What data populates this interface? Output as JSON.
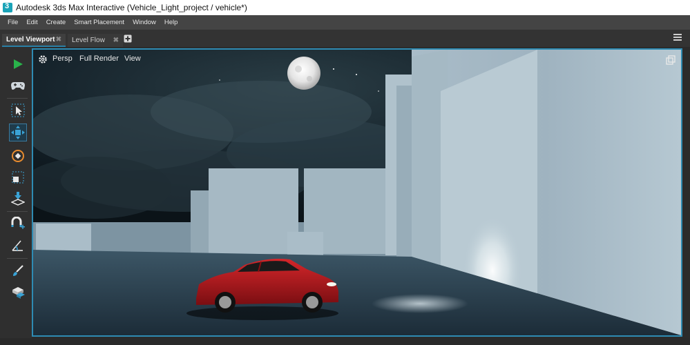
{
  "window": {
    "title": "Autodesk 3ds Max Interactive (Vehicle_Light_project / vehicle*)"
  },
  "menu": [
    "File",
    "Edit",
    "Create",
    "Smart Placement",
    "Window",
    "Help"
  ],
  "tabs": [
    {
      "label": "Level Viewport",
      "active": true
    },
    {
      "label": "Level Flow",
      "active": false
    }
  ],
  "viewport": {
    "camera_label": "Persp",
    "render_label": "Full Render",
    "view_label": "View"
  },
  "toolbar": {
    "tools": [
      "play-icon",
      "gamepad-icon",
      "select-icon",
      "move-icon",
      "rotate-icon",
      "scale-icon",
      "place-on-surface-icon",
      "snap-magnet-icon",
      "angle-snap-icon",
      "paint-brush-icon",
      "layers-icon"
    ]
  },
  "colors": {
    "accent": "#2e8bb3",
    "play": "#29b24a",
    "car": "#b3181c"
  }
}
